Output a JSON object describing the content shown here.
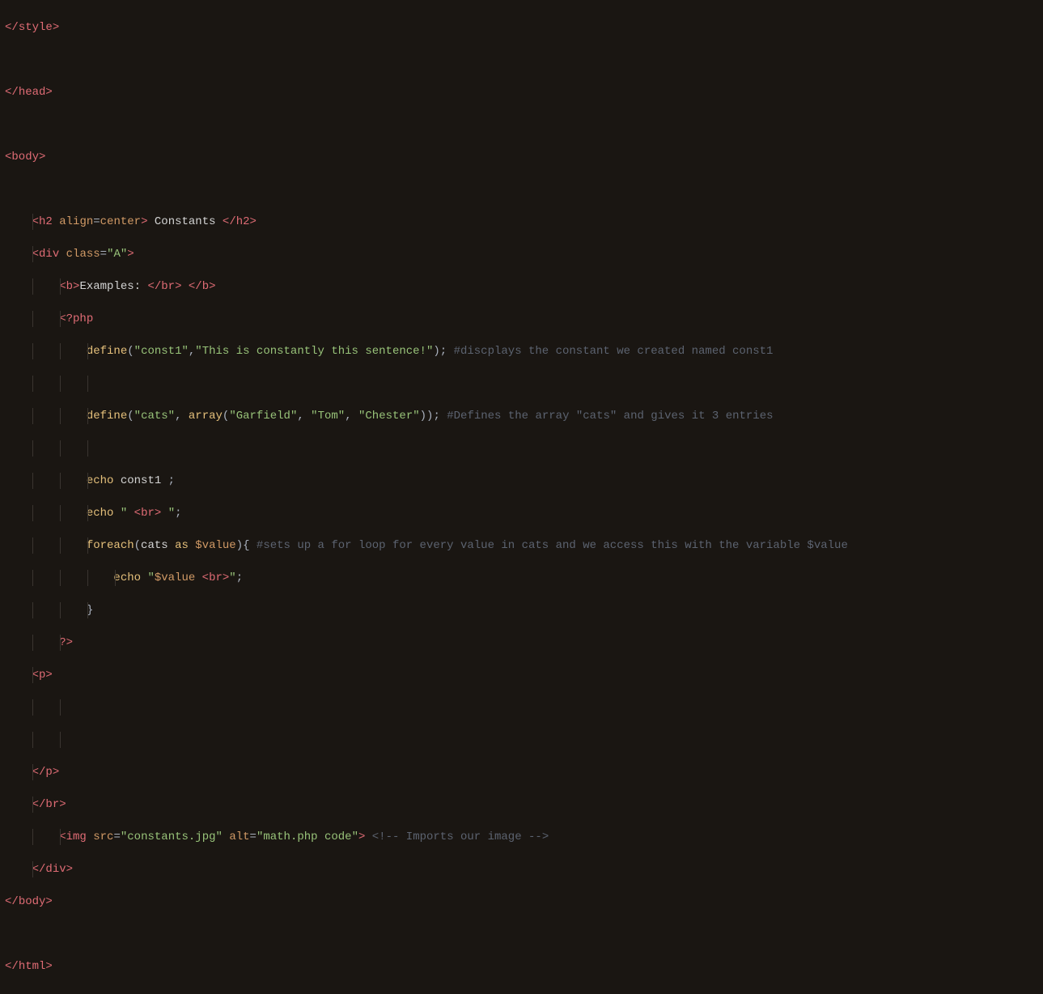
{
  "code": {
    "l1": {
      "tag_close": "</",
      "style": "style",
      "gt": ">"
    },
    "l2": {
      "tag_close": "</",
      "head": "head",
      "gt": ">"
    },
    "l3": {
      "tag_open": "<",
      "body": "body",
      "gt": ">"
    },
    "l4": {
      "tag_open": "<",
      "h2": "h2",
      "sp": " ",
      "align": "align",
      "eq": "=",
      "center": "center",
      "gt": ">",
      "sp2": " ",
      "text": "Constants",
      "sp3": " ",
      "tag_close": "</",
      "h2_2": "h2",
      "gt2": ">"
    },
    "l5": {
      "tag_open": "<",
      "div": "div",
      "sp": " ",
      "class": "class",
      "eq": "=",
      "q1": "\"",
      "a": "A",
      "q2": "\"",
      "gt": ">"
    },
    "l6": {
      "tag_open": "<",
      "b": "b",
      "gt": ">",
      "text": "Examples:",
      "sp": " ",
      "tag_close": "</",
      "br": "br",
      "gt2": ">",
      "sp2": " ",
      "tag_close2": "</",
      "b2": "b",
      "gt3": ">"
    },
    "l7": {
      "php_open": "<?",
      "php": "php"
    },
    "l8": {
      "define": "define",
      "p1": "(",
      "q1": "\"",
      "const1": "const1",
      "q2": "\"",
      "comma": ",",
      "q3": "\"",
      "sentence": "This is constantly this sentence!",
      "q4": "\"",
      "p2": ")",
      "semi": ";",
      "sp": " ",
      "comment": "#discplays the constant we created named const1"
    },
    "l9": {
      "define": "define",
      "p1": "(",
      "q1": "\"",
      "cats": "cats",
      "q2": "\"",
      "comma": ",",
      "sp": " ",
      "array": "array",
      "p2": "(",
      "q3": "\"",
      "garfield": "Garfield",
      "q4": "\"",
      "comma2": ",",
      "sp2": " ",
      "q5": "\"",
      "tom": "Tom",
      "q6": "\"",
      "comma3": ",",
      "sp3": " ",
      "q7": "\"",
      "chester": "Chester",
      "q8": "\"",
      "p3": ")",
      "p4": ")",
      "semi": ";",
      "sp4": " ",
      "comment": "#Defines the array \"cats\" and gives it 3 entries"
    },
    "l10": {
      "echo": "echo",
      "sp": " ",
      "const1": "const1",
      "sp2": " ",
      "semi": ";"
    },
    "l11": {
      "echo": "echo",
      "sp": " ",
      "q1": "\"",
      "sp2": " ",
      "lt": "<",
      "br": "br",
      "gt": ">",
      "sp3": " ",
      "q2": "\"",
      "semi": ";"
    },
    "l12": {
      "foreach": "foreach",
      "p1": "(",
      "cats": "cats",
      "sp": " ",
      "as": "as",
      "sp2": " ",
      "value": "$value",
      "p2": ")",
      "brace": "{",
      "sp3": " ",
      "comment": "#sets up a for loop for every value in cats and we access this with the variable $value"
    },
    "l13": {
      "echo": "echo",
      "sp": " ",
      "q1": "\"",
      "value": "$value",
      "sp2": " ",
      "lt": "<",
      "br": "br",
      "gt": ">",
      "q2": "\"",
      "semi": ";"
    },
    "l14": {
      "brace": "}"
    },
    "l15": {
      "php_close": "?>"
    },
    "l16": {
      "tag_open": "<",
      "p": "p",
      "gt": ">"
    },
    "l17": {
      "tag_close": "</",
      "p": "p",
      "gt": ">"
    },
    "l18": {
      "tag_close": "</",
      "br": "br",
      "gt": ">"
    },
    "l19": {
      "tag_open": "<",
      "img": "img",
      "sp": " ",
      "src": "src",
      "eq": "=",
      "q1": "\"",
      "file": "constants.jpg",
      "q2": "\"",
      "sp2": " ",
      "alt": "alt",
      "eq2": "=",
      "q3": "\"",
      "alttext": "math.php code",
      "q4": "\"",
      "gt": ">",
      "sp3": " ",
      "comment": "<!-- Imports our image -->"
    },
    "l20": {
      "tag_close": "</",
      "div": "div",
      "gt": ">"
    },
    "l21": {
      "tag_close": "</",
      "body": "body",
      "gt": ">"
    },
    "l22": {
      "tag_close": "</",
      "html": "html",
      "gt": ">"
    }
  }
}
